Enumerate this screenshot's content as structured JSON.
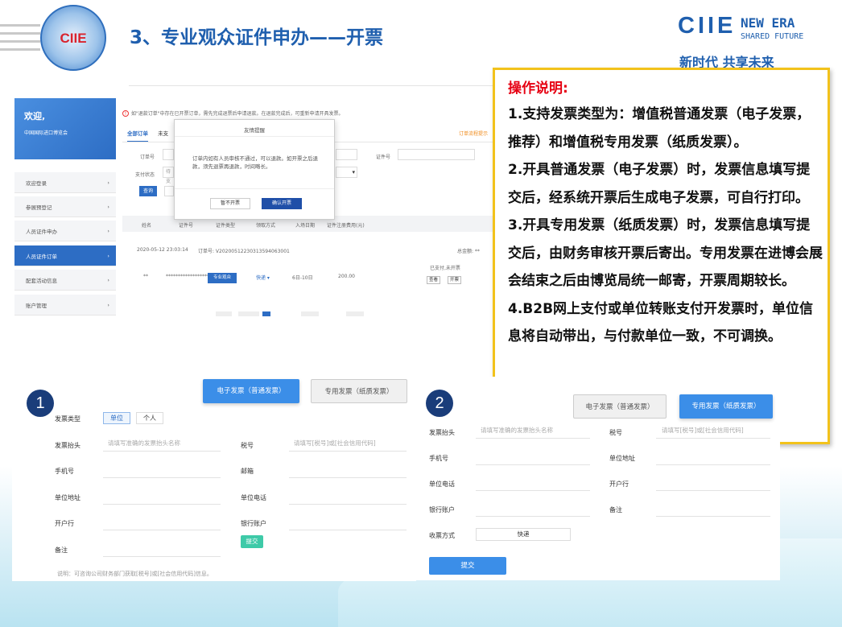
{
  "header": {
    "logo_text": "CIIE",
    "title": "3、专业观众证件申办——开票",
    "brand_ciie": "CIIE",
    "brand_new_era": "NEW ERA",
    "brand_shared": "SHARED FUTURE",
    "brand_slogan": "新时代 共享未来"
  },
  "portal": {
    "welcome_title": "欢迎,",
    "welcome_org": "中国国际进口博览会",
    "nav": [
      {
        "label": "欢迎登录"
      },
      {
        "label": "参展预登记"
      },
      {
        "label": "人员证件申办"
      },
      {
        "label": "人员证件订单"
      },
      {
        "label": "配套活动信息"
      },
      {
        "label": "账户管理"
      }
    ],
    "notice": "如\"退款订单\"中存在已开票订单，需先完成退票后申请退款。在退款完成后，可重新申请开具发票。",
    "tabs": [
      "全部订单",
      "未支"
    ],
    "orange_link": "订单流程提示",
    "filters": {
      "order_no": "订单号",
      "pay_status": "支付状态",
      "pay_status_value": "待支",
      "cert_no": "证件号"
    },
    "query_btn": "查询",
    "columns": [
      "姓名",
      "证件号",
      "证件类型",
      "领取方式",
      "入场日期",
      "证件注册费用(元)"
    ],
    "order_time": "2020-05-12 23:03:14",
    "order_no": "订单号: V2020051223031359406300​1",
    "total": "总金额: **",
    "row": {
      "name": "**",
      "cert": "******************",
      "type": "专业观众",
      "delivery": "快递 ▾",
      "dates": "6日-10日",
      "fee": "200.00",
      "status": "已支付,未开票",
      "view": "查看",
      "invoice": "开票"
    },
    "modal": {
      "title": "友情提醒",
      "body": "订单内如有人员审核不通过，可以退款。如开票之后退款，须先退票再退款，时间略长。",
      "cancel": "暂不开票",
      "confirm": "确认开票"
    }
  },
  "instructions": {
    "heading": "操作说明:",
    "items": [
      "1.支持发票类型为：增值税普通发票（电子发票，推荐）和增值税专用发票（纸质发票）。",
      "2.开具普通发票（电子发票）时，发票信息填写提交后，经系统开票后生成电子发票，可自行打印。",
      "3.开具专用发票（纸质发票）时，发票信息填写提交后，由财务审核开票后寄出。专用发票在进博会展会结束之后由博览局统一邮寄，开票周期较长。",
      "4.B2B网上支付或单位转账支付开发票时，单位信息将自动带出，与付款单位一致，不可调换。"
    ]
  },
  "form1": {
    "badge": "1",
    "btn_electronic": "电子发票（普通发票）",
    "btn_paper": "专用发票（纸质发票）",
    "invoice_type_label": "发票类型",
    "type_unit": "单位",
    "type_personal": "个人",
    "title_label": "发票抬头",
    "title_ph": "请填写准确的发票抬头名称",
    "tax_label": "税号",
    "tax_ph": "请填写[税号]或[社会信用代码]",
    "phone_label": "手机号",
    "email_label": "邮箱",
    "addr_label": "单位地址",
    "unit_phone_label": "单位电话",
    "bank_label": "开户行",
    "account_label": "银行账户",
    "remark_label": "备注",
    "submit": "提交",
    "note": "说明：可咨询公司财务部门获取[税号]或[社会信用代码]信息。"
  },
  "form2": {
    "badge": "2",
    "btn_electronic": "电子发票（普通发票）",
    "btn_paper": "专用发票（纸质发票）",
    "title_label": "发票抬头",
    "title_ph": "请填写准确的发票抬头名称",
    "tax_label": "税号",
    "tax_ph": "请填写[税号]或[社会信用代码]",
    "phone_label": "手机号",
    "addr_label": "单位地址",
    "unit_phone_label": "单位电话",
    "bank_label": "开户行",
    "account_label": "银行账户",
    "remark_label": "备注",
    "receive_label": "收票方式",
    "receive_value": "快递",
    "submit": "提交"
  }
}
